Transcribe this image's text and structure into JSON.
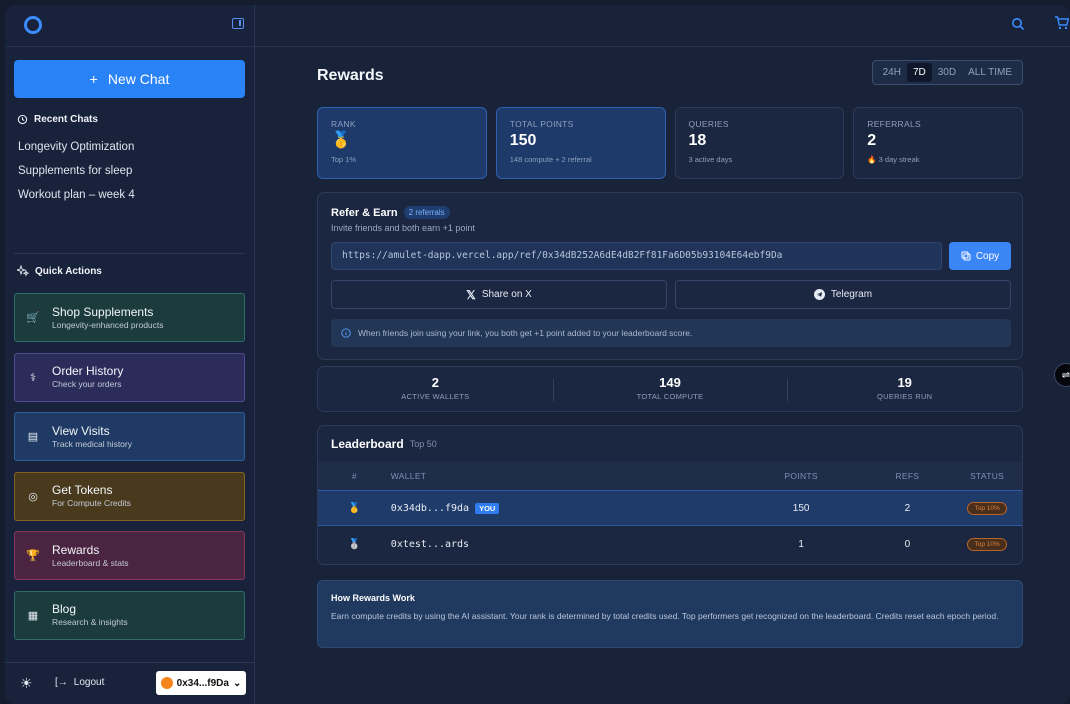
{
  "sidebar": {
    "new_chat_label": "New Chat",
    "recent_heading": "Recent Chats",
    "recent_chats": [
      "Longevity Optimization",
      "Supplements for sleep",
      "Workout plan – week 4"
    ],
    "quick_actions_heading": "Quick Actions",
    "quick_actions": [
      {
        "title": "Shop Supplements",
        "subtitle": "Longevity-enhanced products",
        "icon": "cart-icon",
        "bg": "#1b3b3c",
        "border": "#2e6d66"
      },
      {
        "title": "Order History",
        "subtitle": "Check your orders",
        "icon": "stethoscope-icon",
        "bg": "#2b2c5a",
        "border": "#4f4b92"
      },
      {
        "title": "View Visits",
        "subtitle": "Track medical history",
        "icon": "document-icon",
        "bg": "#1f3a64",
        "border": "#2e5f9c"
      },
      {
        "title": "Get Tokens",
        "subtitle": "For Compute Credits",
        "icon": "target-icon",
        "bg": "#4a3a1d",
        "border": "#7f6326"
      },
      {
        "title": "Rewards",
        "subtitle": "Leaderboard & stats",
        "icon": "trophy-icon",
        "bg": "#4a2440",
        "border": "#86355e"
      },
      {
        "title": "Blog",
        "subtitle": "Research & insights",
        "icon": "notebook-icon",
        "bg": "#1b3b3c",
        "border": "#2e6d66"
      }
    ],
    "logout_label": "Logout",
    "wallet_label": "0x34...f9Da"
  },
  "main": {
    "title": "Rewards",
    "tabs": [
      "24H",
      "7D",
      "30D",
      "ALL TIME"
    ],
    "active_tab": "7D",
    "stats": [
      {
        "label": "RANK",
        "value": "🥇",
        "sub": "Top 1%"
      },
      {
        "label": "TOTAL POINTS",
        "value": "150",
        "sub": "148 compute + 2 referral"
      },
      {
        "label": "QUERIES",
        "value": "18",
        "sub": "3 active days"
      },
      {
        "label": "REFERRALS",
        "value": "2",
        "sub": "🔥 3 day streak"
      }
    ],
    "refer": {
      "title": "Refer & Earn",
      "badge": "2 referrals",
      "subtitle": "Invite friends and both earn +1 point",
      "link": "https://amulet-dapp.vercel.app/ref/0x34dB252A6dE4dB2Ff81Fa6D05b93104E64ebf9Da",
      "copy_label": "Copy",
      "share_x_label": "Share on X",
      "telegram_label": "Telegram",
      "info": "When friends join using your link, you both get +1 point added to your leaderboard score."
    },
    "summary": [
      {
        "value": "2",
        "label": "ACTIVE WALLETS"
      },
      {
        "value": "149",
        "label": "TOTAL COMPUTE"
      },
      {
        "value": "19",
        "label": "QUERIES RUN"
      }
    ],
    "leaderboard": {
      "title": "Leaderboard",
      "subtitle": "Top 50",
      "columns": [
        "#",
        "WALLET",
        "POINTS",
        "REFS",
        "STATUS"
      ],
      "rows": [
        {
          "rank": "🥇",
          "wallet": "0x34db...f9da",
          "you": "YOU",
          "points": "150",
          "refs": "2",
          "status": "Top 10%"
        },
        {
          "rank": "🥈",
          "wallet": "0xtest...ards",
          "points": "1",
          "refs": "0",
          "status": "Top 10%"
        }
      ]
    },
    "how": {
      "title": "How Rewards Work",
      "body": "Earn compute credits by using the AI assistant. Your rank is determined by total credits used. Top performers get recognized on the leaderboard. Credits reset each epoch period."
    }
  }
}
